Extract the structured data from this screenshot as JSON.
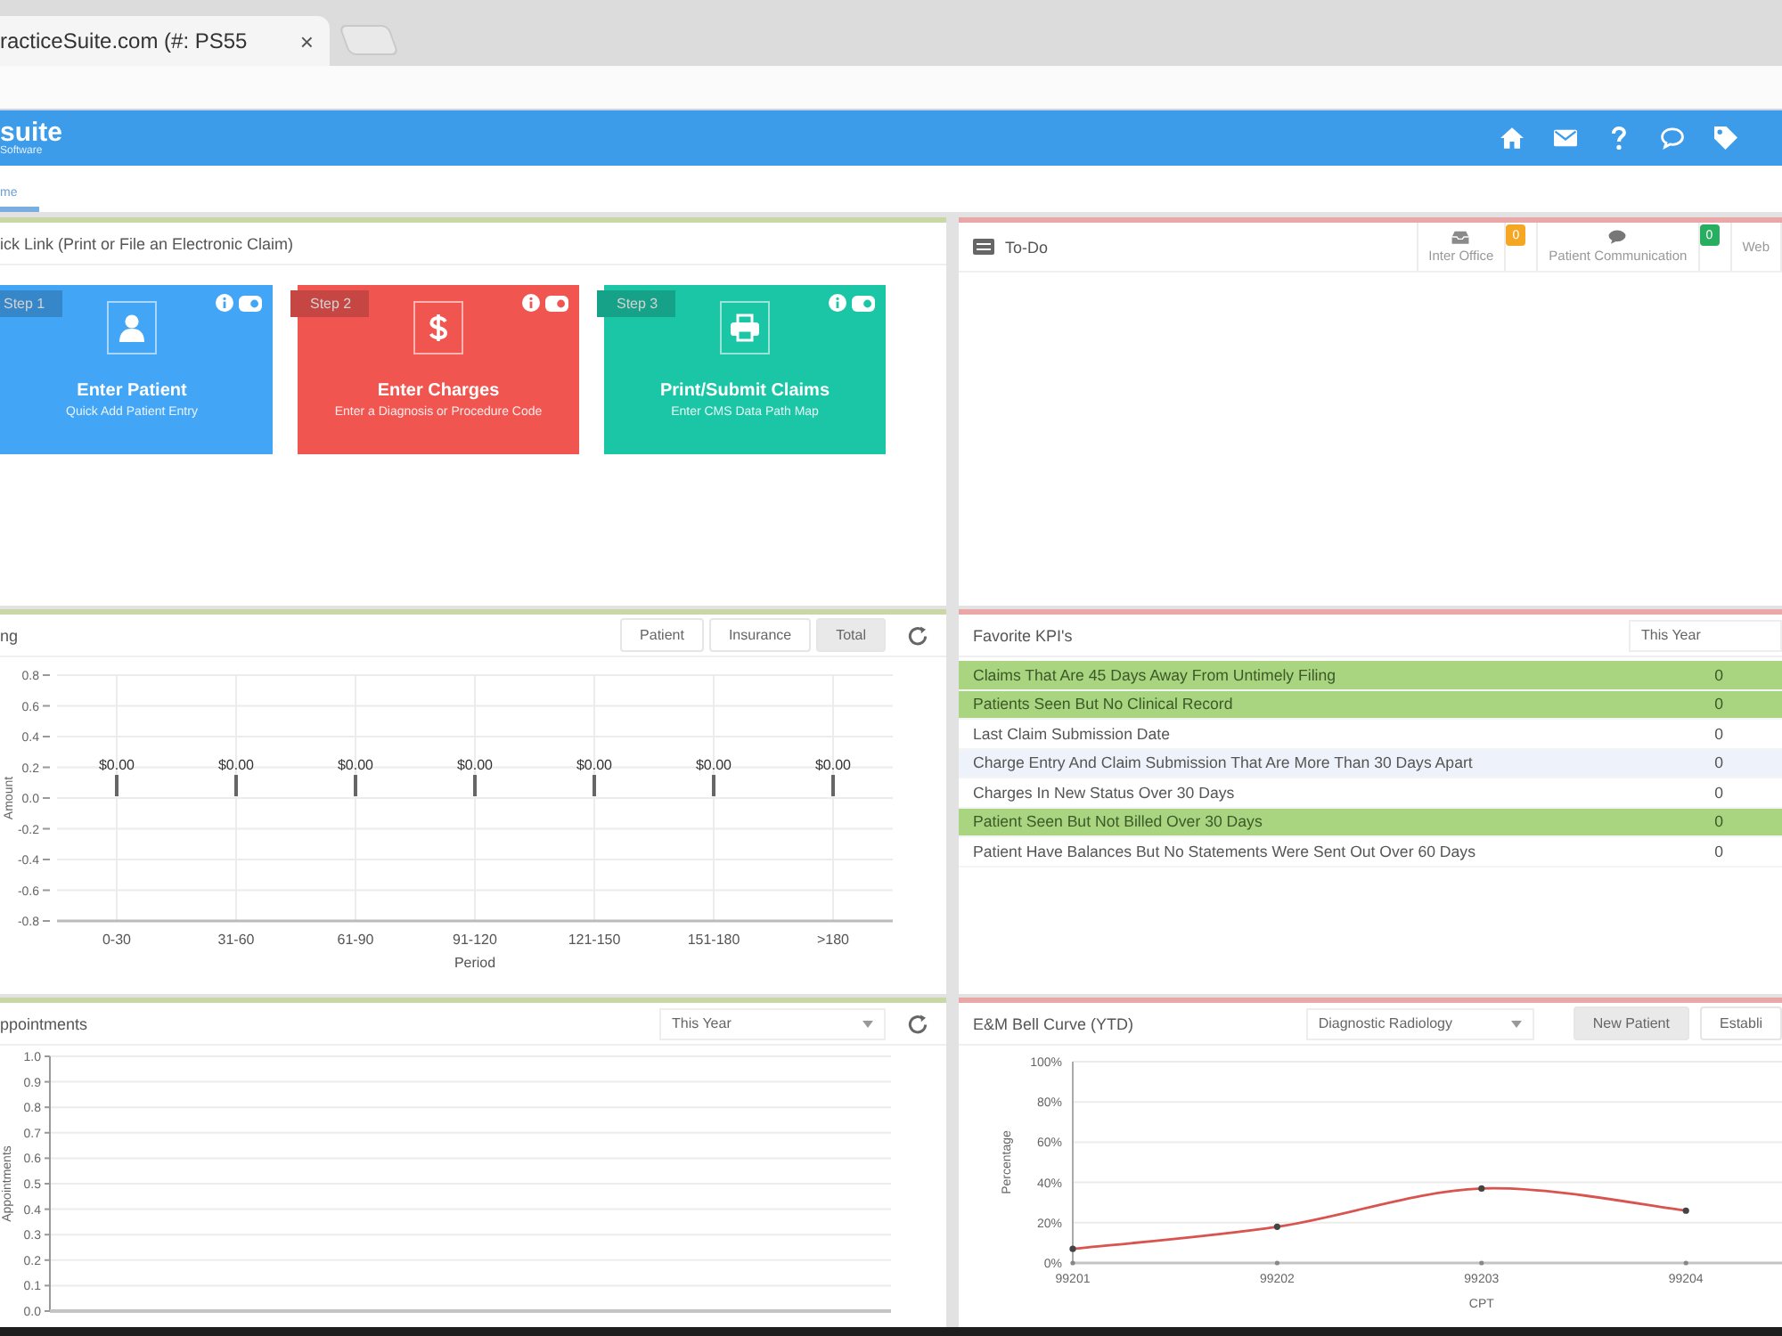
{
  "browser_tab": {
    "title": "racticeSuite.com (#: PS55",
    "close": "×"
  },
  "app_header": {
    "logo": "suite",
    "logo_subtitle": "Software"
  },
  "nav": {
    "tabs": [
      {
        "label": "me",
        "selected": true
      }
    ]
  },
  "quick_link": {
    "title": "ick Link (Print or File an Electronic Claim)",
    "cards": [
      {
        "step": "Step 1",
        "title": "Enter Patient",
        "subtitle": "Quick Add Patient Entry",
        "kind": "patient",
        "color": "#42a5f5"
      },
      {
        "step": "Step 2",
        "title": "Enter Charges",
        "subtitle": "Enter a Diagnosis or Procedure Code",
        "kind": "charges",
        "color": "#f05550"
      },
      {
        "step": "Step 3",
        "title": "Print/Submit Claims",
        "subtitle": "Enter CMS Data Path Map",
        "kind": "claims",
        "color": "#1bc6a6"
      }
    ]
  },
  "todo": {
    "title": "To-Do",
    "tabs": [
      {
        "label": "Inter Office",
        "kind": "inbox",
        "badge": "0",
        "color": "#f5a623"
      },
      {
        "label": "Patient Communication",
        "kind": "chat",
        "badge": "0",
        "color": "#27ae60"
      },
      {
        "label": "Web",
        "kind": "plain"
      }
    ]
  },
  "aging": {
    "title": "ng",
    "filters": [
      {
        "label": "Patient",
        "selected": false
      },
      {
        "label": "Insurance",
        "selected": false
      },
      {
        "label": "Total",
        "selected": true
      }
    ],
    "chart_data": {
      "type": "bar",
      "xlabel": "Period",
      "ylabel": "Amount",
      "grid": true,
      "categories": [
        "0-30",
        "31-60",
        "61-90",
        "91-120",
        "121-150",
        "151-180",
        ">180"
      ],
      "values": [
        0,
        0,
        0,
        0,
        0,
        0,
        0
      ],
      "value_labels": [
        "$0.00",
        "$0.00",
        "$0.00",
        "$0.00",
        "$0.00",
        "$0.00",
        "$0.00"
      ],
      "ylim": [
        -0.8,
        0.8
      ],
      "yticks": [
        {
          "value": 0.8,
          "label": "0.8"
        },
        {
          "value": 0.6,
          "label": "0.6"
        },
        {
          "value": 0.4,
          "label": "0.4"
        },
        {
          "value": 0.2,
          "label": "0.2"
        },
        {
          "value": 0,
          "label": "0.0"
        },
        {
          "value": -0.2,
          "label": "-0.2"
        },
        {
          "value": -0.4,
          "label": "-0.4"
        },
        {
          "value": -0.6,
          "label": "-0.6"
        },
        {
          "value": -0.8,
          "label": "-0.8"
        }
      ]
    }
  },
  "kpi": {
    "title": "Favorite KPI's",
    "period": "This Year",
    "rows": [
      {
        "label": "Claims That Are 45 Days Away From Untimely Filing",
        "value": "0",
        "flagged": true,
        "hovered": false
      },
      {
        "label": "Patients Seen But No Clinical Record",
        "value": "0",
        "flagged": true,
        "hovered": false
      },
      {
        "label": "Last Claim Submission Date",
        "value": "0",
        "flagged": false,
        "hovered": false
      },
      {
        "label": "Charge Entry And Claim Submission That Are More Than 30 Days Apart",
        "value": "0",
        "flagged": false,
        "hovered": true
      },
      {
        "label": "Charges In New Status Over 30 Days",
        "value": "0",
        "flagged": false,
        "hovered": false
      },
      {
        "label": "Patient Seen But Not Billed Over 30 Days",
        "value": "0",
        "flagged": true,
        "hovered": false
      },
      {
        "label": "Patient Have Balances But No Statements Were Sent Out Over 60 Days",
        "value": "0",
        "flagged": false,
        "hovered": false
      }
    ]
  },
  "appointments": {
    "title": "ppointments",
    "period": "This Year",
    "empty_chart": {
      "y_title": "Appointments",
      "y_ticks": [
        "1.0",
        "0.9",
        "0.8",
        "0.7",
        "0.6",
        "0.5",
        "0.4",
        "0.3",
        "0.2",
        "0.1",
        "0.0"
      ]
    }
  },
  "bell_curve": {
    "title": "E&M Bell Curve (YTD)",
    "specialty": "Diagnostic Radiology",
    "tabs": [
      {
        "label": "New Patient",
        "selected": true
      },
      {
        "label": "Establi",
        "selected": false
      }
    ],
    "chart_data": {
      "type": "line",
      "xlabel": "CPT",
      "ylabel": "Percentage",
      "grid": true,
      "categories": [
        "99201",
        "99202",
        "99203",
        "99204"
      ],
      "series": [
        {
          "color": "#d9534f",
          "marker": true,
          "values": [
            7,
            18,
            37,
            26
          ]
        }
      ],
      "ylim": [
        0,
        100
      ],
      "yticks": [
        {
          "value": 100,
          "label": "100%"
        },
        {
          "value": 80,
          "label": "80%"
        },
        {
          "value": 60,
          "label": "60%"
        },
        {
          "value": 40,
          "label": "40%"
        },
        {
          "value": 20,
          "label": "20%"
        },
        {
          "value": 0,
          "label": "0%"
        }
      ]
    }
  }
}
